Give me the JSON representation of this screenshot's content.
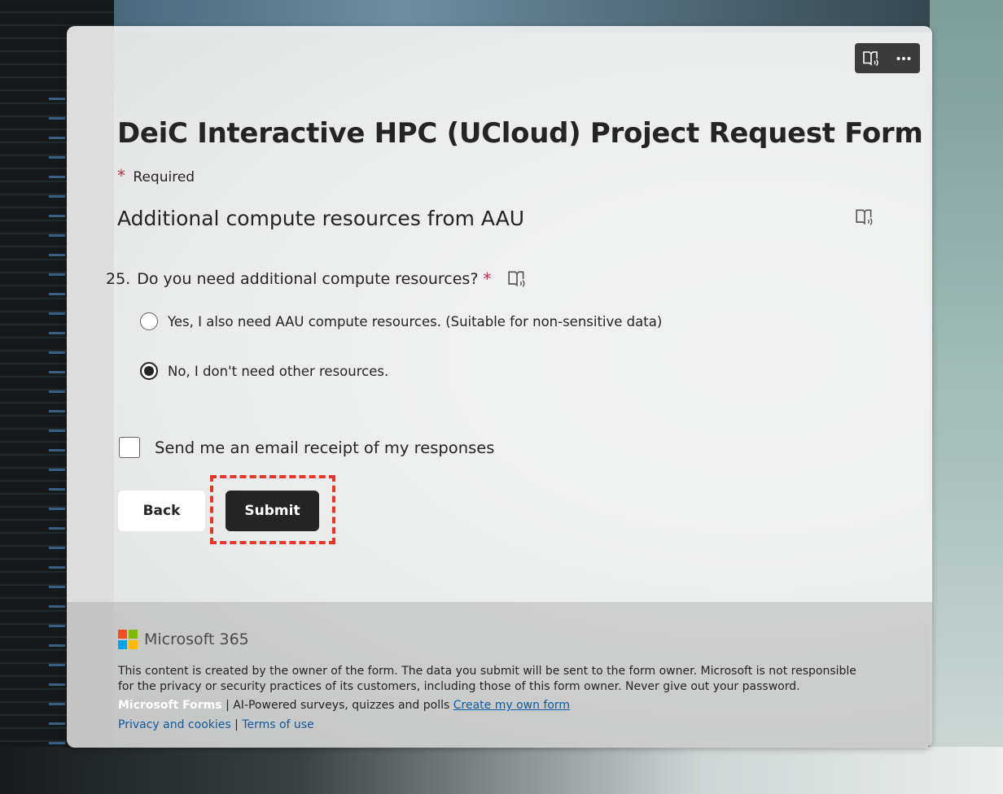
{
  "toolbar": {
    "immersive_reader_icon": "immersive-reader-icon",
    "more_icon": "more-options-icon"
  },
  "form": {
    "title": "DeiC Interactive HPC (UCloud) Project Request Form",
    "required_star": "*",
    "required_label": "Required",
    "section_title": "Additional compute resources from AAU"
  },
  "question": {
    "number": "25.",
    "text": "Do you need additional compute resources?",
    "required_star": "*",
    "options": [
      {
        "label": "Yes, I also need AAU compute resources. (Suitable for non-sensitive data)",
        "selected": false
      },
      {
        "label": "No, I don't need other resources.",
        "selected": true
      }
    ]
  },
  "receipt": {
    "label": "Send me an email receipt of my responses",
    "checked": false
  },
  "buttons": {
    "back": "Back",
    "submit": "Submit"
  },
  "footer": {
    "brand": "Microsoft 365",
    "disclaimer": "This content is created by the owner of the form. The data you submit will be sent to the form owner. Microsoft is not responsible for the privacy or security practices of its customers, including those of this form owner. Never give out your password.",
    "forms_brand": "Microsoft Forms",
    "forms_separator": "|",
    "forms_tagline": "AI-Powered surveys, quizzes and polls",
    "create_link": "Create my own form",
    "privacy_link": "Privacy and cookies",
    "legal_separator": "|",
    "terms_link": "Terms of use"
  },
  "colors": {
    "required_star": "#c4314b",
    "submit_bg": "#242424",
    "highlight": "#e8352b",
    "link": "#0f5a9e",
    "ms_red": "#f25022",
    "ms_green": "#7fba00",
    "ms_blue": "#00a4ef",
    "ms_yellow": "#ffb900"
  }
}
